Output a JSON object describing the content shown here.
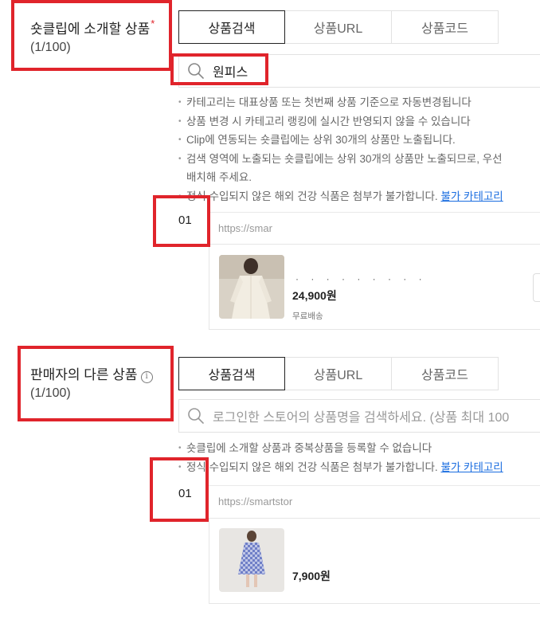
{
  "section1": {
    "title": "숏클립에 소개할 상품",
    "required_mark": "*",
    "count": "(1/100)",
    "tabs": [
      "상품검색",
      "상품URL",
      "상품코드"
    ],
    "search_value": "원피스",
    "notes": [
      "카테고리는 대표상품 또는 첫번째 상품 기준으로 자동변경됩니다",
      "상품 변경 시 카테고리 랭킹에 실시간 반영되지 않을 수 있습니다",
      "Clip에 연동되는 숏클립에는 상위 30개의 상품만 노출됩니다.",
      "검색 영역에 노출되는 숏클립에는 상위 30개의 상품만 노출되므로, 우선",
      "배치해 주세요.",
      "정식 수입되지 않은 해외 건강 식품은 첨부가 불가합니다."
    ],
    "note_link": "불가 카테고리",
    "item_index": "01",
    "item_url": "https://smar",
    "item_name": "· · · · · · · · ·",
    "item_price": "24,900원",
    "item_shipping": "무료배송"
  },
  "section2": {
    "title": "판매자의 다른 상품",
    "info_icon": "i",
    "count": "(1/100)",
    "tabs": [
      "상품검색",
      "상품URL",
      "상품코드"
    ],
    "search_placeholder": "로그인한 스토어의 상품명을 검색하세요. (상품 최대 100",
    "notes": [
      "숏클립에 소개할 상품과 중복상품을 등록할 수 없습니다",
      "정식 수입되지 않은 해외 건강 식품은 첨부가 불가합니다."
    ],
    "note_link": "불가 카테고리",
    "item_index": "01",
    "item_url": "https://smartstor",
    "item_price": "7,900원"
  },
  "colors": {
    "highlight": "#e0242b",
    "link": "#1a6de0",
    "active_tab_border": "#222222"
  },
  "icons": [
    "search-icon",
    "info-icon"
  ]
}
